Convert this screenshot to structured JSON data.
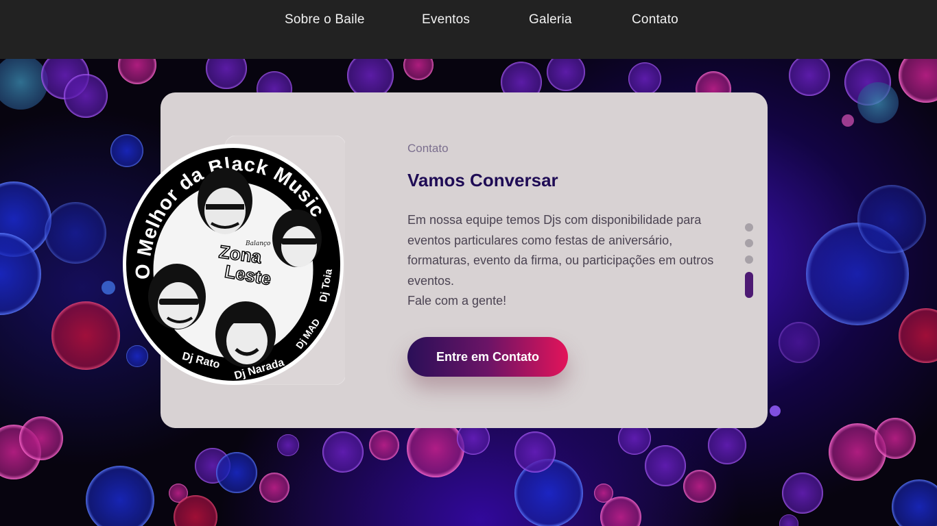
{
  "nav": {
    "items": [
      {
        "label": "Sobre o Baile"
      },
      {
        "label": "Eventos"
      },
      {
        "label": "Galeria"
      },
      {
        "label": "Contato"
      }
    ]
  },
  "contact_section": {
    "eyebrow": "Contato",
    "title": "Vamos Conversar",
    "body_lines": [
      "Em nossa equipe temos Djs com disponibilidade para",
      "eventos particulares como festas de aniversário,",
      "formaturas, evento da firma, ou participações em outros",
      "eventos.",
      "Fale com a gente!"
    ],
    "cta_label": "Entre em Contato"
  },
  "logo": {
    "arc_text": "O Melhor da Black Music",
    "center_text_top": "Zona",
    "center_text_bottom": "Leste",
    "center_small": "Balanço",
    "djs": [
      "Dj Rato",
      "Dj Narada",
      "Dj MAD",
      "Dj Toia"
    ]
  },
  "pager": {
    "count": 4,
    "active_index": 3
  },
  "colors": {
    "navbar_bg": "#222222",
    "card_bg": "#d8d2d3",
    "title": "#1f0c55",
    "accent_start": "#2a0f58",
    "accent_end": "#e3145a",
    "pager_active": "#4d1a73"
  }
}
